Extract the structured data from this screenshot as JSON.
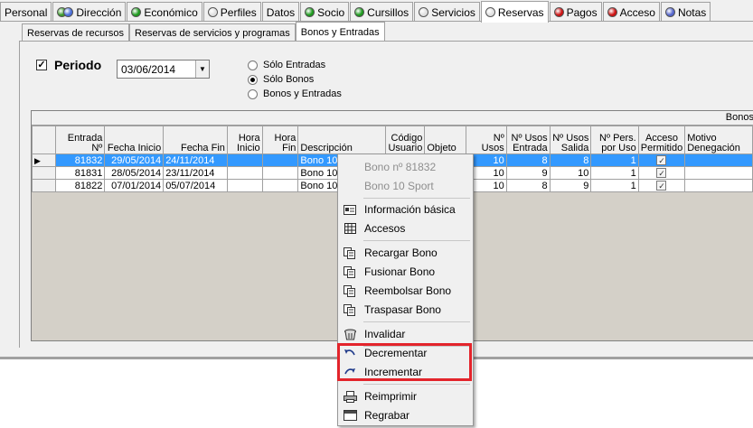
{
  "top_tabs": [
    {
      "label": "Personal",
      "dots": []
    },
    {
      "label": "Dirección",
      "dots": [
        "#3a9a2a",
        "#4a6ed8"
      ]
    },
    {
      "label": "Económico",
      "dots": [
        "#1e9a1e"
      ]
    },
    {
      "label": "Perfiles",
      "dots": [
        "#e0e0e0"
      ]
    },
    {
      "label": "Datos",
      "dots": []
    },
    {
      "label": "Socio",
      "dots": [
        "#1e9a1e"
      ]
    },
    {
      "label": "Cursillos",
      "dots": [
        "#1e9a1e"
      ]
    },
    {
      "label": "Servicios",
      "dots": [
        "#e0e0e0"
      ]
    },
    {
      "label": "Reservas",
      "dots": [
        "#e0e0e0"
      ],
      "active": true
    },
    {
      "label": "Pagos",
      "dots": [
        "#cc1111"
      ]
    },
    {
      "label": "Acceso",
      "dots": [
        "#cc1111"
      ]
    },
    {
      "label": "Notas",
      "dots": [
        "#5566cc"
      ]
    }
  ],
  "sub_tabs": [
    "Reservas de recursos",
    "Reservas de servicios y programas",
    "Bonos y Entradas"
  ],
  "periodo": {
    "label": "Periodo",
    "checked": true,
    "date": "03/06/2014"
  },
  "radios": [
    {
      "label": "Sólo Entradas",
      "selected": false
    },
    {
      "label": "Sólo Bonos",
      "selected": true
    },
    {
      "label": "Bonos y Entradas",
      "selected": false
    }
  ],
  "grid": {
    "group_header": "Bonos",
    "columns": [
      "Entrada Nº",
      "Fecha Inicio",
      "Fecha Fin",
      "Hora Inicio",
      "Hora Fin",
      "Descripción",
      "Código Usuario",
      "Objeto",
      "Nº Usos",
      "Nº Usos Entrada",
      "Nº Usos Salida",
      "Nº Pers. por Uso",
      "Acceso Permitido",
      "Motivo Denegación"
    ],
    "rows": [
      {
        "entrada": "81832",
        "inicio": "29/05/2014",
        "fin": "24/11/2014",
        "desc": "Bono 10",
        "usos": "10",
        "usos_entrada": "8",
        "usos_salida": "8",
        "pers": "1",
        "acceso": true,
        "selected": true
      },
      {
        "entrada": "81831",
        "inicio": "28/05/2014",
        "fin": "23/11/2014",
        "desc": "Bono 10",
        "usos": "10",
        "usos_entrada": "9",
        "usos_salida": "10",
        "pers": "1",
        "acceso": true,
        "selected": false
      },
      {
        "entrada": "81822",
        "inicio": "07/01/2014",
        "fin": "05/07/2014",
        "desc": "Bono 10",
        "usos": "10",
        "usos_entrada": "8",
        "usos_salida": "9",
        "pers": "1",
        "acceso": true,
        "selected": false
      }
    ]
  },
  "context_menu": {
    "header1": "Bono nº 81832",
    "header2": "Bono 10 Sport",
    "items": [
      {
        "label": "Información básica",
        "icon": "info-card-icon"
      },
      {
        "label": "Accesos",
        "icon": "grid-table-icon"
      },
      {
        "label": "Recargar Bono",
        "icon": "copy-pages-icon"
      },
      {
        "label": "Fusionar Bono",
        "icon": "copy-pages-icon"
      },
      {
        "label": "Reembolsar Bono",
        "icon": "copy-pages-icon"
      },
      {
        "label": "Traspasar Bono",
        "icon": "copy-pages-icon"
      },
      {
        "label": "Invalidar",
        "icon": "trash-icon"
      },
      {
        "label": "Decrementar",
        "icon": "undo-arrow-icon"
      },
      {
        "label": "Incrementar",
        "icon": "redo-arrow-icon"
      },
      {
        "label": "Reimprimir",
        "icon": "printer-icon"
      },
      {
        "label": "Regrabar",
        "icon": "card-write-icon"
      }
    ]
  }
}
